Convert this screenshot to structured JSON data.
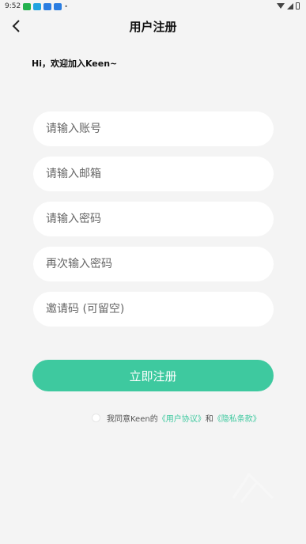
{
  "status_bar": {
    "time": "9:52",
    "notification_icons": [
      "app-green-icon",
      "app-blue-icon",
      "app-blue-icon",
      "app-blue-icon"
    ],
    "extra_dot": "•"
  },
  "header": {
    "title": "用户注册",
    "back_icon": "chevron-left-icon"
  },
  "greeting": "Hi，欢迎加入Keen~",
  "form": {
    "account_placeholder": "请输入账号",
    "email_placeholder": "请输入邮箱",
    "password_placeholder": "请输入密码",
    "confirm_password_placeholder": "再次输入密码",
    "invite_code_placeholder": "邀请码 (可留空)"
  },
  "submit_label": "立即注册",
  "agreement": {
    "prefix": "我同意Keen的",
    "user_agreement": "《用户协议》",
    "conjunction": "和",
    "privacy_policy": "《隐私条款》"
  },
  "colors": {
    "accent": "#3ec99f",
    "background": "#f4f4f4",
    "field": "#ffffff"
  }
}
